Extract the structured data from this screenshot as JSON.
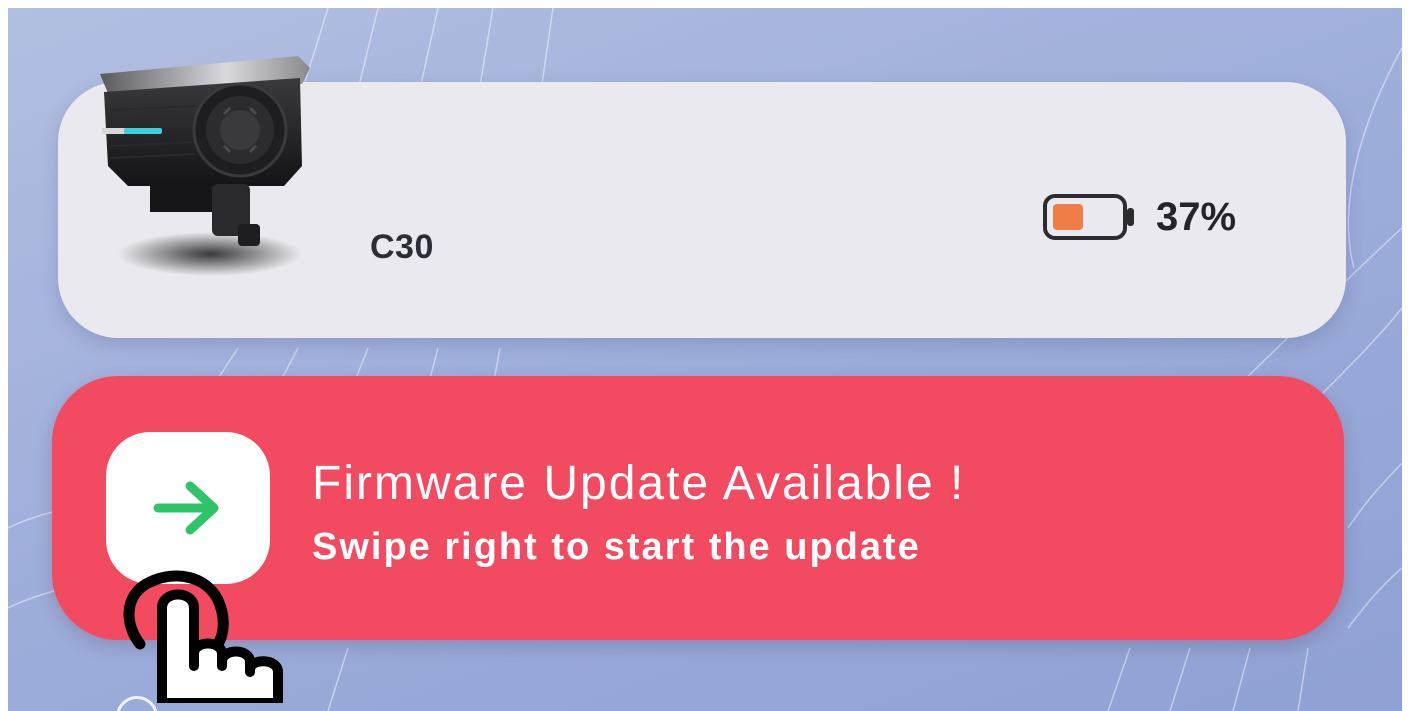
{
  "device": {
    "name": "C30",
    "battery_percent": "37%",
    "battery_level": 0.37,
    "battery_color": "#ee7d46",
    "image_icon": "intercom-device-icon"
  },
  "update_banner": {
    "title": "Firmware Update Available !",
    "subtitle": "Swipe right to start the update",
    "background_color": "#f24a60",
    "handle_icon": "arrow-right-icon",
    "handle_icon_color": "#2ec46a"
  },
  "overlay": {
    "gesture_icon": "tap-hand-icon"
  },
  "colors": {
    "card_background": "#e9e9ef",
    "screen_background": "#9fb0da"
  }
}
